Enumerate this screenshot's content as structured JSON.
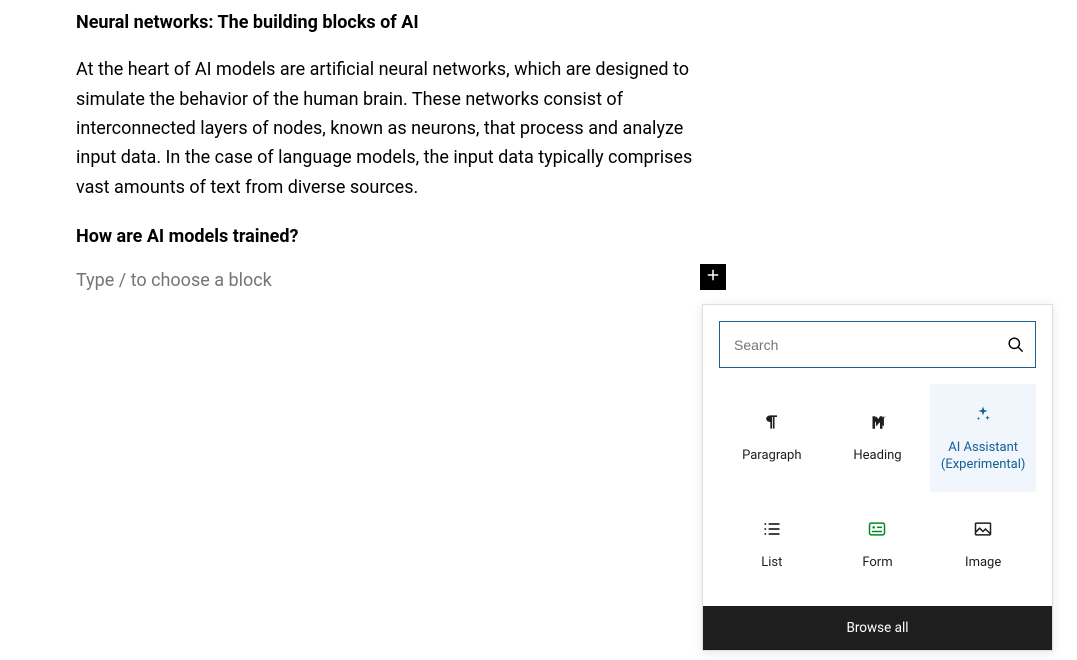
{
  "content": {
    "heading1": "Neural networks: The building blocks of AI",
    "paragraph1": "At the heart of AI models are artificial neural networks, which are designed to simulate the behavior of the human brain. These networks consist of interconnected layers of nodes, known as neurons, that process and analyze input data. In the case of language models, the input data typically comprises vast amounts of text from diverse sources.",
    "heading2": "How are AI models trained?",
    "placeholder": "Type / to choose a block"
  },
  "popover": {
    "search_placeholder": "Search",
    "blocks": {
      "paragraph": "Paragraph",
      "heading": "Heading",
      "ai_assistant": "AI Assistant (Experimental)",
      "list": "List",
      "form": "Form",
      "image": "Image"
    },
    "browse_all": "Browse all"
  }
}
